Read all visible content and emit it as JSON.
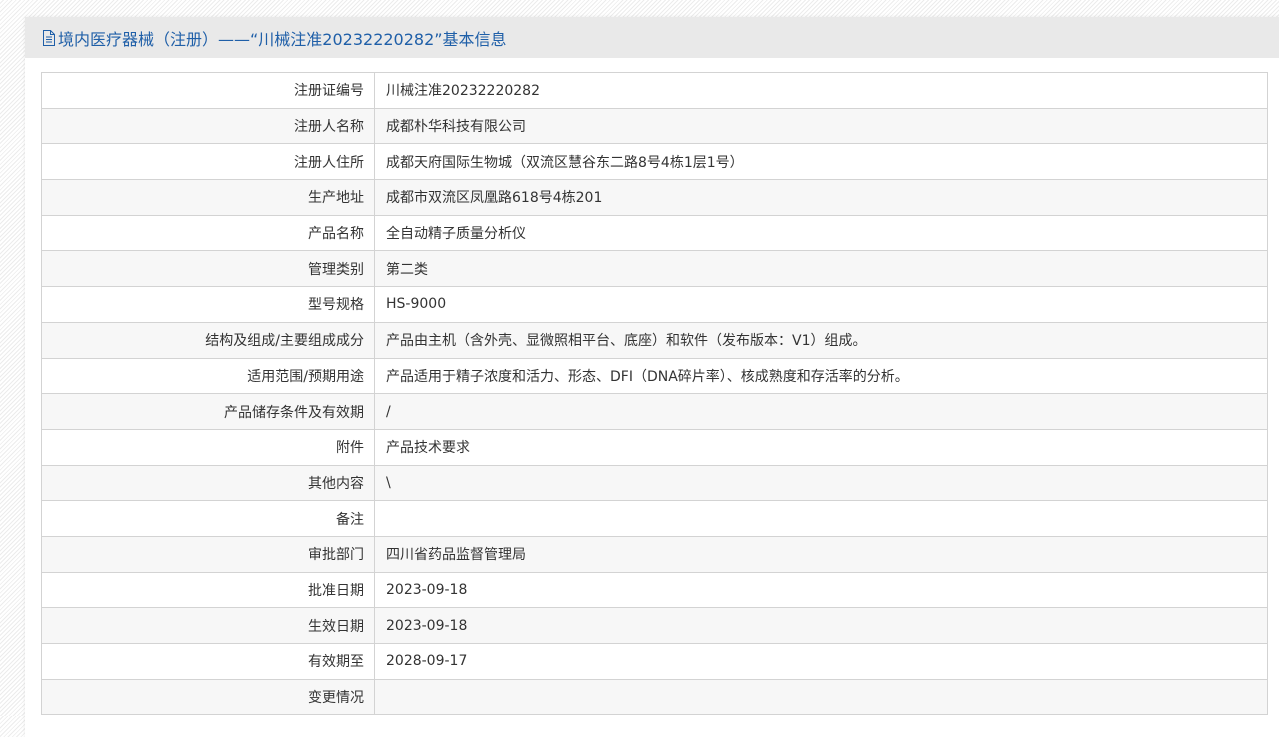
{
  "header": {
    "title": "境内医疗器械（注册）——“川械注准20232220282”基本信息",
    "icon": "document-icon"
  },
  "rows": [
    {
      "label": "注册证编号",
      "value": "川械注准20232220282"
    },
    {
      "label": "注册人名称",
      "value": "成都朴华科技有限公司"
    },
    {
      "label": "注册人住所",
      "value": "成都天府国际生物城（双流区慧谷东二路8号4栋1层1号）"
    },
    {
      "label": "生产地址",
      "value": "成都市双流区凤凰路618号4栋201"
    },
    {
      "label": "产品名称",
      "value": "全自动精子质量分析仪"
    },
    {
      "label": "管理类别",
      "value": "第二类"
    },
    {
      "label": "型号规格",
      "value": "HS-9000"
    },
    {
      "label": "结构及组成/主要组成成分",
      "value": "产品由主机（含外壳、显微照相平台、底座）和软件（发布版本：V1）组成。"
    },
    {
      "label": "适用范围/预期用途",
      "value": "产品适用于精子浓度和活力、形态、DFI（DNA碎片率）、核成熟度和存活率的分析。"
    },
    {
      "label": "产品储存条件及有效期",
      "value": "/"
    },
    {
      "label": "附件",
      "value": "产品技术要求"
    },
    {
      "label": "其他内容",
      "value": "\\"
    },
    {
      "label": "备注",
      "value": ""
    },
    {
      "label": "审批部门",
      "value": "四川省药品监督管理局"
    },
    {
      "label": "批准日期",
      "value": "2023-09-18"
    },
    {
      "label": "生效日期",
      "value": "2023-09-18"
    },
    {
      "label": "有效期至",
      "value": "2028-09-17"
    },
    {
      "label": "变更情况",
      "value": ""
    }
  ]
}
